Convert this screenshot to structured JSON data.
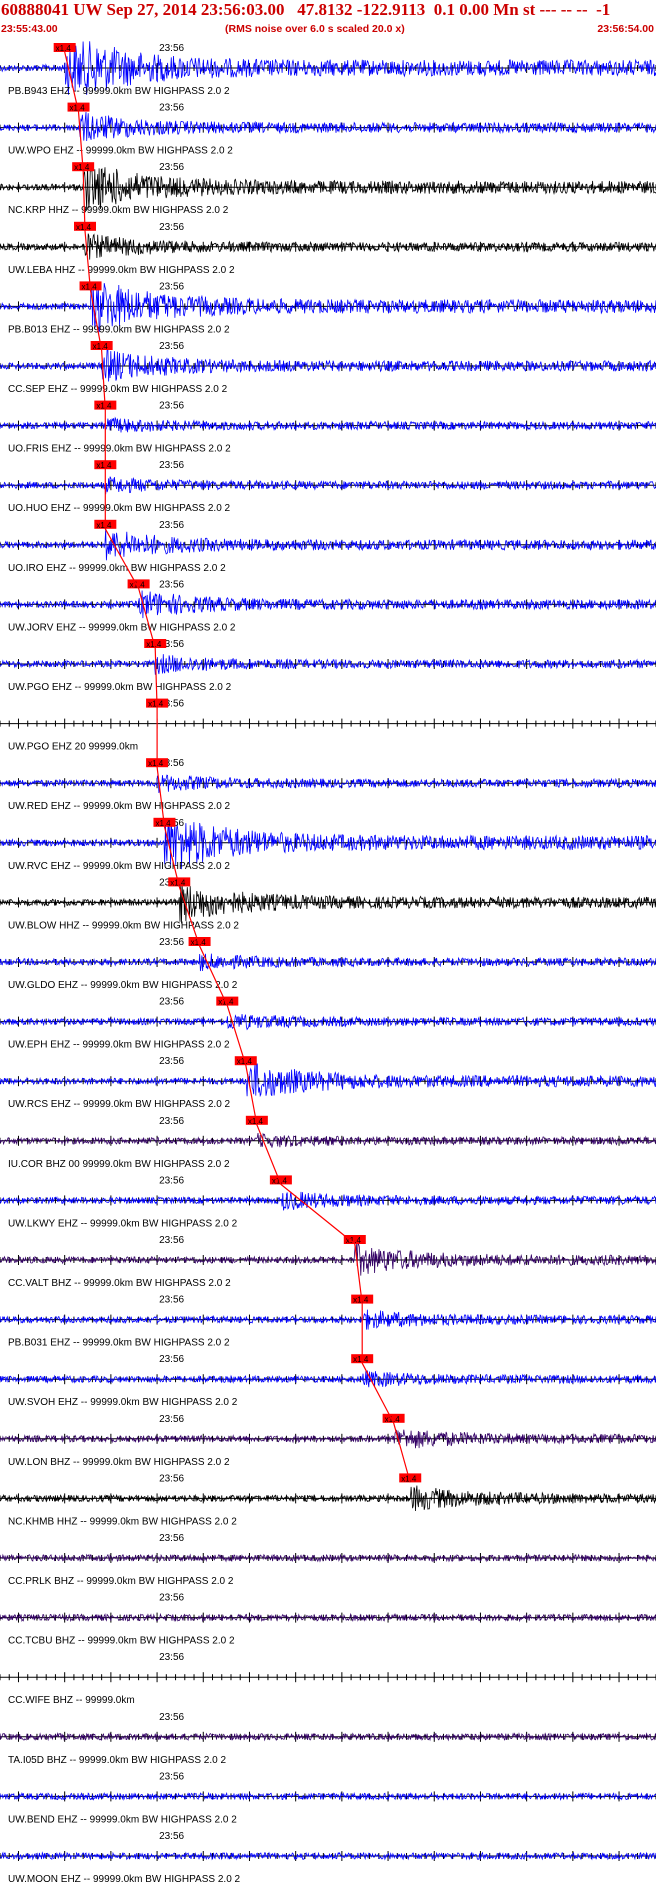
{
  "header": {
    "title": "60888041 UW Sep 27, 2014 23:56:03.00   47.8132 -122.9113  0.1 0.00 Mn st --- -- --  -1",
    "start_time": "23:55:43.00",
    "rms_note": "(RMS noise over 6.0 s scaled 20.0 x)",
    "end_time": "23:56:54.00"
  },
  "colors": {
    "header_text": "#cc0000",
    "pick": "#ff0000",
    "axis": "#000000",
    "blue": "#0000ff",
    "black": "#000000",
    "purple": "#330066"
  },
  "chart_data": {
    "type": "line",
    "title": "60888041 UW Sep 27, 2014 23:56:03.00   47.8132 -122.9113  0.1 0.00 Mn st --- -- --  -1",
    "x_range": [
      "23:55:43.00",
      "23:56:54.00"
    ],
    "x_tick_label": "23:56",
    "pick_label": "x1.4",
    "traces": [
      {
        "label": "PB.B943 EHZ -- 99999.0km BW  HIGHPASS  2.0  2",
        "color": "blue",
        "pick": "23:55:50.0",
        "amp": 1.2
      },
      {
        "label": "UW.WPO EHZ -- 99999.0km BW  HIGHPASS  2.0  2",
        "color": "blue",
        "pick": "23:55:51.5",
        "amp": 0.45
      },
      {
        "label": "NC.KRP HHZ -- 99999.0km BW  HIGHPASS  2.0  2",
        "color": "black",
        "pick": "23:55:52.0",
        "amp": 0.8
      },
      {
        "label": "UW.LEBA HHZ -- 99999.0km BW  HIGHPASS  2.0  2",
        "color": "black",
        "pick": "23:55:52.2",
        "amp": 0.35
      },
      {
        "label": "PB.B013 EHZ -- 99999.0km BW  HIGHPASS  2.0  2",
        "color": "blue",
        "pick": "23:55:52.8",
        "amp": 0.9
      },
      {
        "label": "CC.SEP EHZ -- 99999.0km BW  HIGHPASS  2.0  2",
        "color": "blue",
        "pick": "23:55:54.0",
        "amp": 0.5
      },
      {
        "label": "UO.FRIS EHZ -- 99999.0km BW  HIGHPASS  2.0  2",
        "color": "blue",
        "pick": "23:55:54.4",
        "amp": 0.18
      },
      {
        "label": "UO.HUO EHZ -- 99999.0km BW  HIGHPASS  2.0  2",
        "color": "blue",
        "pick": "23:55:54.4",
        "amp": 0.2
      },
      {
        "label": "UO.IRO EHZ -- 99999.0km BW  HIGHPASS  2.0  2",
        "color": "blue",
        "pick": "23:55:54.4",
        "amp": 0.45
      },
      {
        "label": "UW.JORV EHZ -- 99999.0km BW  HIGHPASS  2.0  2",
        "color": "blue",
        "pick": "23:55:58.0",
        "amp": 0.4
      },
      {
        "label": "UW.PGO EHZ -- 99999.0km BW  HIGHPASS  2.0  2",
        "color": "blue",
        "pick": "23:55:59.8",
        "amp": 0.25
      },
      {
        "label": "UW.PGO EHZ 20 99999.0km",
        "color": "blue",
        "pick": "23:56:00.0",
        "amp": 0.0
      },
      {
        "label": "UW.RED EHZ -- 99999.0km BW  HIGHPASS  2.0  2",
        "color": "blue",
        "pick": "23:56:00.0",
        "amp": 0.22
      },
      {
        "label": "UW.RVC EHZ -- 99999.0km BW  HIGHPASS  2.0  2",
        "color": "blue",
        "pick": "23:56:00.8",
        "amp": 1.0
      },
      {
        "label": "UW.BLOW HHZ -- 99999.0km BW  HIGHPASS  2.0  2",
        "color": "black",
        "pick": "23:56:02.4",
        "amp": 0.6
      },
      {
        "label": "UW.GLDO EHZ -- 99999.0km BW  HIGHPASS  2.0  2",
        "color": "blue",
        "pick": "23:56:04.6",
        "amp": 0.2
      },
      {
        "label": "UW.EPH EHZ -- 99999.0km BW  HIGHPASS  2.0  2",
        "color": "blue",
        "pick": "23:56:07.6",
        "amp": 0.2
      },
      {
        "label": "UW.RCS EHZ -- 99999.0km BW  HIGHPASS  2.0  2",
        "color": "blue",
        "pick": "23:56:09.6",
        "amp": 0.6
      },
      {
        "label": "IU.COR BHZ 00 99999.0km BW  HIGHPASS  2.0  2",
        "color": "purple",
        "pick": "23:56:10.8",
        "amp": 0.15
      },
      {
        "label": "UW.LKWY EHZ -- 99999.0km BW  HIGHPASS  2.0  2",
        "color": "blue",
        "pick": "23:56:13.4",
        "amp": 0.25
      },
      {
        "label": "CC.VALT BHZ -- 99999.0km BW  HIGHPASS  2.0  2",
        "color": "purple",
        "pick": "23:56:21.4",
        "amp": 0.45
      },
      {
        "label": "PB.B031 EHZ -- 99999.0km BW  HIGHPASS  2.0  2",
        "color": "blue",
        "pick": "23:56:22.2",
        "amp": 0.25
      },
      {
        "label": "UW.SVOH EHZ -- 99999.0km BW  HIGHPASS  2.0  2",
        "color": "blue",
        "pick": "23:56:22.2",
        "amp": 0.2
      },
      {
        "label": "UW.LON BHZ -- 99999.0km BW  HIGHPASS  2.0  2",
        "color": "purple",
        "pick": "23:56:25.6",
        "amp": 0.3
      },
      {
        "label": "NC.KHMB HHZ -- 99999.0km BW  HIGHPASS  2.0  2",
        "color": "black",
        "pick": "23:56:27.4",
        "amp": 0.35
      },
      {
        "label": "CC.PRLK BHZ -- 99999.0km BW  HIGHPASS  2.0  2",
        "color": "purple",
        "pick": "",
        "amp": 0.1
      },
      {
        "label": "CC.TCBU BHZ -- 99999.0km BW  HIGHPASS  2.0  2",
        "color": "purple",
        "pick": "",
        "amp": 0.12
      },
      {
        "label": "CC.WIFE BHZ -- 99999.0km",
        "color": "blue",
        "pick": "",
        "amp": 0.0
      },
      {
        "label": "TA.I05D BHZ -- 99999.0km BW  HIGHPASS  2.0  2",
        "color": "purple",
        "pick": "",
        "amp": 0.12
      },
      {
        "label": "UW.BEND EHZ -- 99999.0km BW  HIGHPASS  2.0  2",
        "color": "blue",
        "pick": "",
        "amp": 0.12
      },
      {
        "label": "UW.MOON EHZ -- 99999.0km BW  HIGHPASS  2.0  2",
        "color": "blue",
        "pick": "",
        "amp": 0.15
      }
    ]
  }
}
